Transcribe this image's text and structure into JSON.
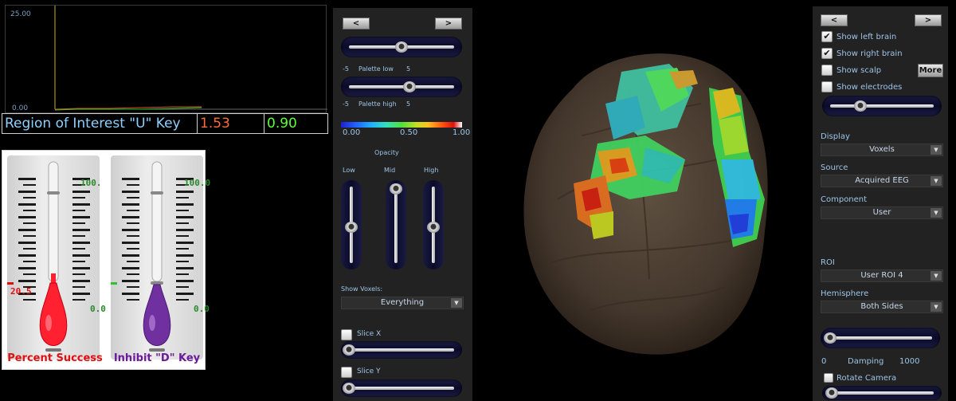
{
  "graph": {
    "y_max": "25.00",
    "y_min": "0.00"
  },
  "roi": {
    "title": "Region of Interest \"U\" Key",
    "value1": "1.53",
    "value2": "0.90"
  },
  "thermometers": [
    {
      "label": "Percent Success",
      "top": "100.",
      "bottom": "0.0",
      "marker": "20.5",
      "level": 0.205,
      "color": "#ff2030",
      "text_color": "#e01010"
    },
    {
      "label": "Inhibit \"D\" Key",
      "top": "100.0",
      "bottom": "0.0",
      "level": 0.1,
      "color": "#7030a0",
      "text_color": "#6a1a9a"
    }
  ],
  "mid_panel": {
    "prev": "<",
    "next": ">",
    "palette_low": {
      "min": "-5",
      "label": "Palette low",
      "max": "5",
      "level": 0.5
    },
    "palette_high": {
      "min": "-5",
      "label": "Palette high",
      "max": "5",
      "level": 0.55
    },
    "scale": [
      "0.00",
      "0.50",
      "1.00"
    ],
    "opacity": {
      "title": "Opacity",
      "low": "Low",
      "mid": "Mid",
      "high": "High",
      "low_level": 0.45,
      "mid_level": 0.9,
      "high_level": 0.45
    },
    "show_voxels_label": "Show Voxels:",
    "show_voxels_value": "Everything",
    "slice_x": "Slice X",
    "slice_y": "Slice Y"
  },
  "right_panel": {
    "prev": "<",
    "next": ">",
    "show_left_brain": "Show left brain",
    "show_right_brain": "Show right brain",
    "show_scalp": "Show scalp",
    "show_electrodes": "Show electrodes",
    "more": "More",
    "display_label": "Display",
    "display_value": "Voxels",
    "source_label": "Source",
    "source_value": "Acquired EEG",
    "component_label": "Component",
    "component_value": "User",
    "roi_label": "ROI",
    "roi_value": "User ROI 4",
    "hemisphere_label": "Hemisphere",
    "hemisphere_value": "Both Sides",
    "damping_min": "0",
    "damping_label": "Damping",
    "damping_max": "1000",
    "rotate_camera": "Rotate Camera"
  },
  "colors": {
    "panel_bg": "#222222",
    "label_text": "#9ec4e8",
    "roi_text": "#8fd0ff",
    "value_orange": "#ff6a3a",
    "value_green": "#5cff3a"
  }
}
